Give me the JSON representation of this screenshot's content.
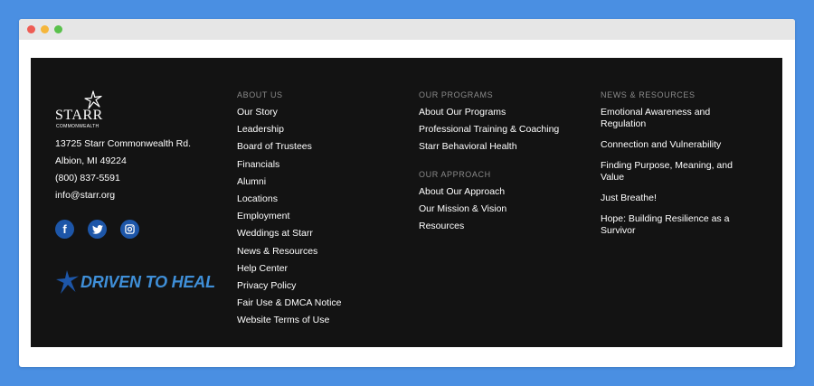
{
  "brand": {
    "logo_word": "STARR",
    "logo_sub": "COMMONWEALTH",
    "address_line1": "13725 Starr Commonwealth Rd.",
    "address_line2": "Albion, MI 49224",
    "phone": "(800) 837-5591",
    "email": "info@starr.org",
    "tagline": "DRIVEN TO HEAL"
  },
  "social": [
    {
      "icon": "facebook-icon",
      "glyph": "f"
    },
    {
      "icon": "twitter-icon"
    },
    {
      "icon": "instagram-icon"
    }
  ],
  "about": {
    "heading": "ABOUT US",
    "links": [
      "Our Story",
      "Leadership",
      "Board of Trustees",
      "Financials",
      "Alumni",
      "Locations",
      "Employment",
      "Weddings at Starr",
      "News & Resources",
      "Help Center",
      "Privacy Policy",
      "Fair Use & DMCA Notice",
      "Website Terms of Use"
    ]
  },
  "programs": {
    "heading": "OUR PROGRAMS",
    "links": [
      "About Our Programs",
      "Professional Training & Coaching",
      "Starr Behavioral Health"
    ]
  },
  "approach": {
    "heading": "OUR APPROACH",
    "links": [
      "About Our Approach",
      "Our Mission & Vision",
      "Resources"
    ]
  },
  "news": {
    "heading": "NEWS & RESOURCES",
    "links": [
      "Emotional Awareness and Regulation",
      "Connection and Vulnerability",
      "Finding Purpose, Meaning, and Value",
      "Just Breathe!",
      "Hope: Building Resilience as a Survivor"
    ]
  },
  "colors": {
    "page_background": "#4a8fe2",
    "footer_background": "#131313",
    "social_blue": "#1d56a8",
    "tagline_blue": "#3f8fd8",
    "heading_gray": "#8a8a8a"
  }
}
